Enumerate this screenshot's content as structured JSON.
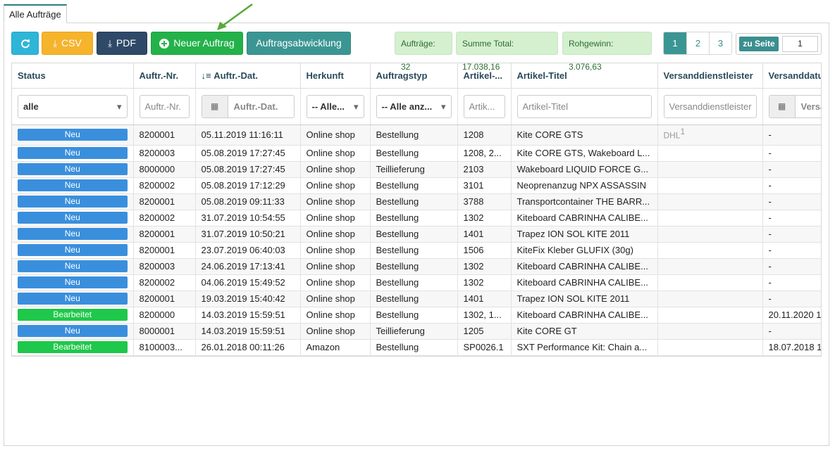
{
  "tab": {
    "label": "Alle Aufträge"
  },
  "toolbar": {
    "csv_label": "CSV",
    "pdf_label": "PDF",
    "new_label": "Neuer Auftrag",
    "process_label": "Auftragsabwicklung"
  },
  "stats": {
    "orders": "Aufträge: 32",
    "total": "Summe Total: 17.038,16",
    "profit": "Rohgewinn: 3.076,63"
  },
  "pagination": {
    "pages": [
      "1",
      "2",
      "3"
    ],
    "goto_label": "zu Seite",
    "goto_value": "1"
  },
  "columns": [
    "Status",
    "Auftr.-Nr.",
    "Auftr.-Dat.",
    "Herkunft",
    "Auftragstyp",
    "Artikel-...",
    "Artikel-Titel",
    "Versanddienstleister",
    "Versanddatu"
  ],
  "filters": {
    "status": "alle",
    "order_no": "Auftr.-Nr.",
    "order_date": "Auftr.-Dat.",
    "origin": "-- Alle...",
    "type": "-- Alle anz...",
    "article_no": "Artik...",
    "article_title": "Artikel-Titel",
    "shipper": "Versanddienstleister",
    "ship_date": "Versa"
  },
  "rows": [
    {
      "status": "Neu",
      "nr": "8200001",
      "date": "05.11.2019 11:16:11",
      "origin": "Online shop",
      "type": "Bestellung",
      "art": "1208",
      "title": "Kite CORE GTS",
      "shipper": "DHL",
      "shipper_sup": "1",
      "ship": "-"
    },
    {
      "status": "Neu",
      "nr": "8200003",
      "date": "05.08.2019 17:27:45",
      "origin": "Online shop",
      "type": "Bestellung",
      "art": "1208, 2...",
      "title": "Kite CORE GTS, Wakeboard L...",
      "shipper": "",
      "shipper_sup": "",
      "ship": "-"
    },
    {
      "status": "Neu",
      "nr": "8000000",
      "date": "05.08.2019 17:27:45",
      "origin": "Online shop",
      "type": "Teillieferung",
      "art": "2103",
      "title": "Wakeboard LIQUID FORCE G...",
      "shipper": "",
      "shipper_sup": "",
      "ship": "-"
    },
    {
      "status": "Neu",
      "nr": "8200002",
      "date": "05.08.2019 17:12:29",
      "origin": "Online shop",
      "type": "Bestellung",
      "art": "3101",
      "title": "Neoprenanzug NPX ASSASSIN",
      "shipper": "",
      "shipper_sup": "",
      "ship": "-"
    },
    {
      "status": "Neu",
      "nr": "8200001",
      "date": "05.08.2019 09:11:33",
      "origin": "Online shop",
      "type": "Bestellung",
      "art": "3788",
      "title": "Transportcontainer THE BARR...",
      "shipper": "",
      "shipper_sup": "",
      "ship": "-"
    },
    {
      "status": "Neu",
      "nr": "8200002",
      "date": "31.07.2019 10:54:55",
      "origin": "Online shop",
      "type": "Bestellung",
      "art": "1302",
      "title": "Kiteboard CABRINHA CALIBE...",
      "shipper": "",
      "shipper_sup": "",
      "ship": "-"
    },
    {
      "status": "Neu",
      "nr": "8200001",
      "date": "31.07.2019 10:50:21",
      "origin": "Online shop",
      "type": "Bestellung",
      "art": "1401",
      "title": "Trapez ION SOL KITE 2011",
      "shipper": "",
      "shipper_sup": "",
      "ship": "-"
    },
    {
      "status": "Neu",
      "nr": "8200001",
      "date": "23.07.2019 06:40:03",
      "origin": "Online shop",
      "type": "Bestellung",
      "art": "1506",
      "title": "KiteFix Kleber GLUFIX (30g)",
      "shipper": "",
      "shipper_sup": "",
      "ship": "-"
    },
    {
      "status": "Neu",
      "nr": "8200003",
      "date": "24.06.2019 17:13:41",
      "origin": "Online shop",
      "type": "Bestellung",
      "art": "1302",
      "title": "Kiteboard CABRINHA CALIBE...",
      "shipper": "",
      "shipper_sup": "",
      "ship": "-"
    },
    {
      "status": "Neu",
      "nr": "8200002",
      "date": "04.06.2019 15:49:52",
      "origin": "Online shop",
      "type": "Bestellung",
      "art": "1302",
      "title": "Kiteboard CABRINHA CALIBE...",
      "shipper": "",
      "shipper_sup": "",
      "ship": "-"
    },
    {
      "status": "Neu",
      "nr": "8200001",
      "date": "19.03.2019 15:40:42",
      "origin": "Online shop",
      "type": "Bestellung",
      "art": "1401",
      "title": "Trapez ION SOL KITE 2011",
      "shipper": "",
      "shipper_sup": "",
      "ship": "-"
    },
    {
      "status": "Bearbeitet",
      "nr": "8200000",
      "date": "14.03.2019 15:59:51",
      "origin": "Online shop",
      "type": "Bestellung",
      "art": "1302, 1...",
      "title": "Kiteboard CABRINHA CALIBE...",
      "shipper": "",
      "shipper_sup": "",
      "ship": "20.11.2020 1"
    },
    {
      "status": "Neu",
      "nr": "8000001",
      "date": "14.03.2019 15:59:51",
      "origin": "Online shop",
      "type": "Teillieferung",
      "art": "1205",
      "title": "Kite CORE GT",
      "shipper": "",
      "shipper_sup": "",
      "ship": "-"
    },
    {
      "status": "Bearbeitet",
      "nr": "8100003...",
      "date": "26.01.2018 00:11:26",
      "origin": "Amazon",
      "type": "Bestellung",
      "art": "SP0026.1",
      "title": "SXT Performance Kit: Chain a...",
      "shipper": "",
      "shipper_sup": "",
      "ship": "18.07.2018 1"
    }
  ],
  "colors": {
    "accent": "#3b9693",
    "new_badge": "#3a8fdd",
    "done_badge": "#1ec84a",
    "arrow": "#5aa83a"
  }
}
